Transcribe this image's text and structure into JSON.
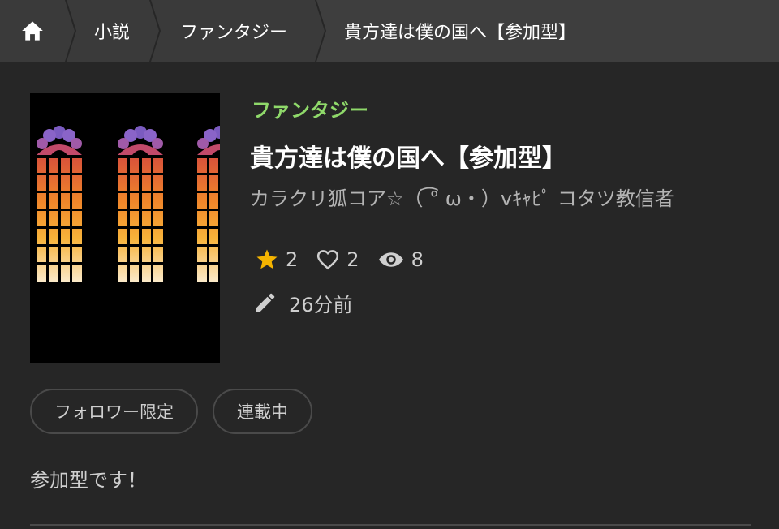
{
  "breadcrumb": {
    "home_icon": "home-icon",
    "items": [
      "小説",
      "ファンタジー",
      "貴方達は僕の国へ【参加型】"
    ]
  },
  "work": {
    "genre": "ファンタジー",
    "title": "貴方達は僕の国へ【参加型】",
    "author": "カラクリ狐コア☆（ ͡° ω・）vｷｬﾋﾟ コタツ教信者",
    "stats": {
      "stars": "2",
      "likes": "2",
      "views": "8"
    },
    "updated": "26分前",
    "tags": [
      "フォロワー限定",
      "連載中"
    ],
    "description": "参加型です！",
    "cover": {
      "description_icon": "stained-glass-windows"
    }
  },
  "colors": {
    "accent_genre": "#8fd96a",
    "star": "#f5b400",
    "background": "#262626"
  }
}
